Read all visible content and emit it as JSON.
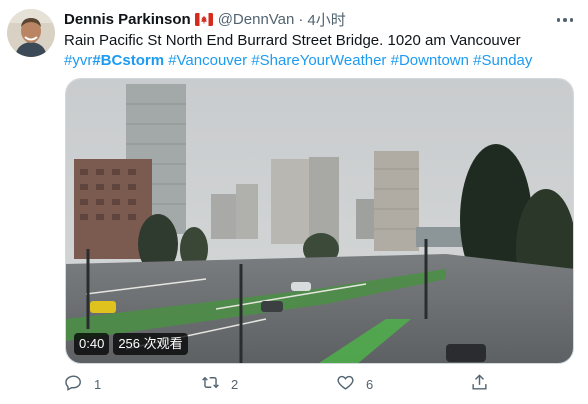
{
  "tweet": {
    "author": {
      "name": "Dennis Parkinson",
      "flag_icon": "canada-flag-icon",
      "handle": "@DennVan",
      "separator": "·",
      "time": "4小时"
    },
    "text_segments": [
      {
        "text": "Rain Pacific St North End Burrard Street Bridge. 1020 am Vancouver ",
        "type": "plain"
      },
      {
        "text": "#yvr",
        "type": "hashtag"
      },
      {
        "text": "#BCstorm",
        "type": "hashtag-bold"
      },
      {
        "text": " ",
        "type": "plain"
      },
      {
        "text": "#Vancouver",
        "type": "hashtag"
      },
      {
        "text": " ",
        "type": "plain"
      },
      {
        "text": "#ShareYourWeather",
        "type": "hashtag"
      },
      {
        "text": " ",
        "type": "plain"
      },
      {
        "text": "#Downtown",
        "type": "hashtag"
      },
      {
        "text": " ",
        "type": "plain"
      },
      {
        "text": "#Sunday",
        "type": "hashtag"
      }
    ],
    "media": {
      "type": "video",
      "duration": "0:40",
      "views": "256 次观看"
    },
    "actions": {
      "reply_icon": "reply-icon",
      "reply_count": "1",
      "retweet_icon": "retweet-icon",
      "retweet_count": "2",
      "like_icon": "like-icon",
      "like_count": "6",
      "share_icon": "share-icon"
    },
    "colors": {
      "link": "#1d9bf0",
      "secondary_text": "#536471",
      "canada_red": "#d52b1e"
    }
  }
}
